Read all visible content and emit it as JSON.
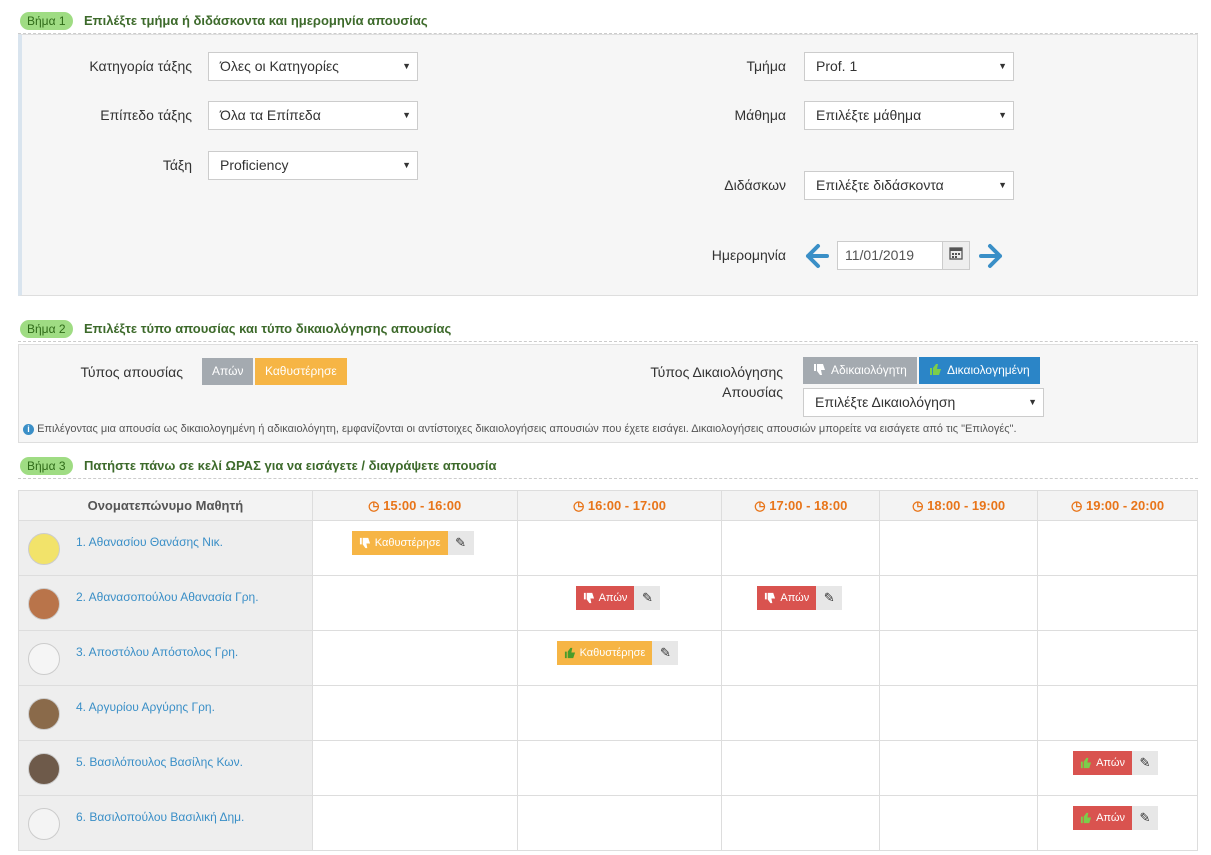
{
  "step1": {
    "badge": "Βήμα 1",
    "title": "Επιλέξτε τμήμα ή διδάσκοντα και ημερομηνία απουσίας",
    "fields": {
      "category_label": "Κατηγορία τάξης",
      "category_value": "Όλες οι Κατηγορίες",
      "level_label": "Επίπεδο τάξης",
      "level_value": "Όλα τα Επίπεδα",
      "class_label": "Τάξη",
      "class_value": "Proficiency",
      "section_label": "Τμήμα",
      "section_value": "Prof. 1",
      "course_label": "Μάθημα",
      "course_value": "Επιλέξτε μάθημα",
      "teacher_label": "Διδάσκων",
      "teacher_value": "Επιλέξτε διδάσκοντα",
      "date_label": "Ημερομηνία",
      "date_value": "11/01/2019"
    }
  },
  "step2": {
    "badge": "Βήμα 2",
    "title": "Επιλέξτε τύπο απουσίας και τύπο δικαιολόγησης απουσίας",
    "absence_type_label": "Τύπος απουσίας",
    "absence_types": [
      "Απών",
      "Καθυστέρησε"
    ],
    "justification_label_line1": "Τύπος Δικαιολόγησης",
    "justification_label_line2": "Απουσίας",
    "justification_types": [
      "Αδικαιολόγητη",
      "Δικαιολογημένη"
    ],
    "justification_select": "Επιλέξτε Δικαιολόγηση",
    "info": "Επιλέγοντας μια απουσία ως δικαιολογημένη ή αδικαιολόγητη, εμφανίζονται οι αντίστοιχες δικαιολογήσεις απουσιών που έχετε εισάγει. Δικαιολογήσεις απουσιών μπορείτε να εισάγετε από τις \"Επιλογές\"."
  },
  "step3": {
    "badge": "Βήμα 3",
    "title": "Πατήστε πάνω σε κελί ΩΡΑΣ για να εισάγετε / διαγράψετε απουσία",
    "name_header": "Ονοματεπώνυμο Μαθητή",
    "hours": [
      "15:00 - 16:00",
      "16:00 - 17:00",
      "17:00 - 18:00",
      "18:00 - 19:00",
      "19:00 - 20:00"
    ],
    "students": [
      {
        "name": "1. Αθανασίου Θανάσης Νικ."
      },
      {
        "name": "2. Αθανασοπούλου Αθανασία Γρη."
      },
      {
        "name": "3. Αποστόλου Απόστολος Γρη."
      },
      {
        "name": "4. Αργυρίου Αργύρης Γρη."
      },
      {
        "name": "5. Βασιλόπουλος Βασίλης Κων."
      },
      {
        "name": "6. Βασιλοπούλου Βασιλική Δημ."
      }
    ],
    "absences": {
      "r1c1": "Καθυστέρησε",
      "r2c2": "Απών",
      "r2c3": "Απών",
      "r3c2": "Καθυστέρησε",
      "r5c5": "Απών",
      "r6c5": "Απών"
    }
  },
  "colors": {
    "accent_green": "#9fdc83",
    "absent_red": "#d9534f",
    "late_orange": "#f6b545",
    "justified_blue": "#2b85c7",
    "hour_orange": "#e8751a",
    "link_blue": "#3a8fc7"
  },
  "icons": [
    "thumbs-down-icon",
    "thumbs-up-icon",
    "pencil-icon",
    "calendar-icon",
    "arrow-left-icon",
    "arrow-right-icon",
    "clock-icon",
    "info-icon",
    "caret-down-icon"
  ]
}
